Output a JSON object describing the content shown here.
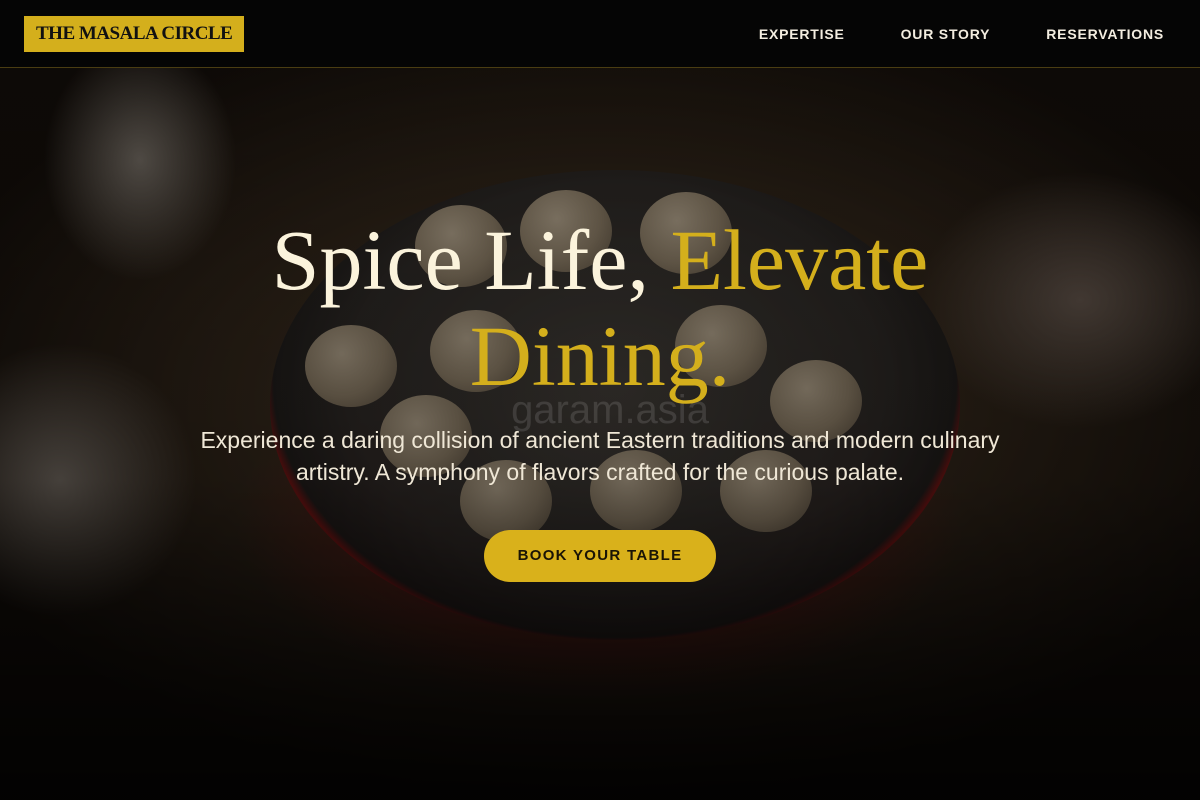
{
  "brand": {
    "logo_text": "THE MASALA CIRCLE",
    "accent_color": "#d4af1c"
  },
  "nav": {
    "items": [
      {
        "label": "EXPERTISE"
      },
      {
        "label": "OUR STORY"
      },
      {
        "label": "RESERVATIONS"
      }
    ]
  },
  "hero": {
    "title_line_1_plain": "Spice Life, ",
    "title_line_1_accent": "Elevate",
    "title_line_2_accent": "Dining.",
    "subtitle": "Experience a daring collision of ancient Eastern traditions and modern culinary artistry. A symphony of flavors crafted for the curious palate.",
    "cta_label": "BOOK YOUR TABLE",
    "watermark_text": "garam.asia"
  }
}
